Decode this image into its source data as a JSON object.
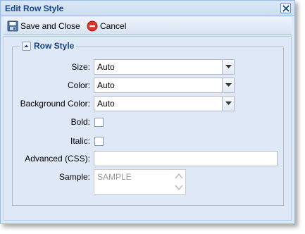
{
  "window": {
    "title": "Edit Row Style"
  },
  "toolbar": {
    "save_label": "Save and Close",
    "cancel_label": "Cancel"
  },
  "group": {
    "title": "Row Style"
  },
  "fields": {
    "size": {
      "label": "Size:",
      "value": "Auto"
    },
    "color": {
      "label": "Color:",
      "value": "Auto"
    },
    "background_color": {
      "label": "Background Color:",
      "value": "Auto"
    },
    "bold": {
      "label": "Bold:",
      "checked": false
    },
    "italic": {
      "label": "Italic:",
      "checked": false
    },
    "advanced_css": {
      "label": "Advanced (CSS):",
      "value": ""
    },
    "sample": {
      "label": "Sample:",
      "value": "SAMPLE"
    }
  },
  "colors": {
    "title_text": "#15428b",
    "panel_bg": "#dfe8f6",
    "border": "#99bbe8",
    "cancel_icon": "#e0322c"
  },
  "icons": {
    "close": "close-icon",
    "save": "save-disk-icon",
    "cancel": "cancel-circle-icon",
    "collapse": "collapse-up-icon",
    "dropdown": "chevron-down-icon"
  }
}
